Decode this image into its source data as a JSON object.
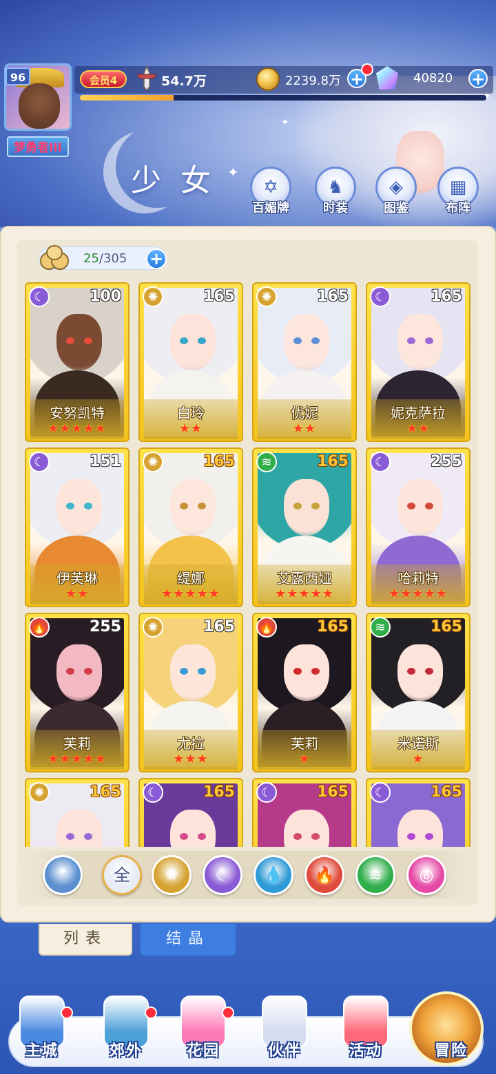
{
  "player": {
    "level": "96",
    "name": "梦勇者III",
    "vip": "会员4",
    "power": "54.7万",
    "exp_fraction": 0.23
  },
  "currency": {
    "gold": "2239.8万",
    "gems": "40820"
  },
  "page_title": "少女",
  "top_buttons": [
    {
      "label": "百媚牌",
      "icon": "card-icon"
    },
    {
      "label": "时装",
      "icon": "outfit-icon"
    },
    {
      "label": "图鉴",
      "icon": "book-icon"
    },
    {
      "label": "布阵",
      "icon": "grid-icon"
    }
  ],
  "collection": {
    "owned": "25",
    "total": "/305"
  },
  "cards": [
    {
      "name": "安努凯特",
      "level": "100",
      "element": "moon",
      "stars": "★★★★★",
      "level_gold": false,
      "hair": "#d9d2c8",
      "skin": "#7a4a33",
      "outfit": "#3a2a22",
      "eye": "#e74c3c"
    },
    {
      "name": "白玲",
      "level": "165",
      "element": "sun",
      "stars": "★★",
      "level_gold": false,
      "hair": "#eeeef2",
      "skin": "#fde3da",
      "outfit": "#f5f3f0",
      "eye": "#3aa6c9"
    },
    {
      "name": "优妮",
      "level": "165",
      "element": "sun",
      "stars": "★★",
      "level_gold": false,
      "hair": "#e8ecf7",
      "skin": "#fde6de",
      "outfit": "#f4f1f0",
      "eye": "#5b8fd6"
    },
    {
      "name": "妮克萨拉",
      "level": "165",
      "element": "moon",
      "stars": "★★",
      "level_gold": false,
      "hair": "#e6e4f3",
      "skin": "#fde6dc",
      "outfit": "#2c2430",
      "eye": "#9b6ad6"
    },
    {
      "name": "伊芙琳",
      "level": "151",
      "element": "moon",
      "stars": "★★",
      "level_gold": false,
      "hair": "#edeef4",
      "skin": "#fde5db",
      "outfit": "#e98a33",
      "eye": "#3fb6c9"
    },
    {
      "name": "缇娜",
      "level": "165",
      "element": "sun",
      "stars": "★★★★★",
      "level_gold": true,
      "hair": "#f2f0ec",
      "skin": "#fde6dc",
      "outfit": "#f2c24b",
      "eye": "#c9923a"
    },
    {
      "name": "艾露西娅",
      "level": "165",
      "element": "wind",
      "stars": "★★★★★",
      "level_gold": true,
      "hair": "#2fa6a6",
      "skin": "#fbe1d6",
      "outfit": "#f5f5f2",
      "eye": "#c8a23a"
    },
    {
      "name": "哈莉特",
      "level": "255",
      "element": "moon",
      "stars": "★★★★★",
      "level_gold": false,
      "hair": "#efeaf5",
      "skin": "#fde5dc",
      "outfit": "#8e6ad2",
      "eye": "#d44a3a"
    },
    {
      "name": "芙莉",
      "level": "255",
      "element": "fire",
      "stars": "★★★★★",
      "level_gold": false,
      "hair": "#2a1c24",
      "skin": "#f2b9c2",
      "outfit": "#3b2a30",
      "eye": "#d33a4a"
    },
    {
      "name": "尤拉",
      "level": "165",
      "element": "sun",
      "stars": "★★★",
      "level_gold": false,
      "hair": "#f6d27a",
      "skin": "#fde5d9",
      "outfit": "#f5f3ee",
      "eye": "#3a9ad6"
    },
    {
      "name": "芙莉",
      "level": "165",
      "element": "fire",
      "stars": "★",
      "level_gold": true,
      "hair": "#1d1820",
      "skin": "#fde3da",
      "outfit": "#2b1e24",
      "eye": "#d12a2a"
    },
    {
      "name": "米诺斯",
      "level": "165",
      "element": "wind",
      "stars": "★",
      "level_gold": true,
      "hair": "#222025",
      "skin": "#fde4db",
      "outfit": "#f3f3f4",
      "eye": "#c22a3a"
    },
    {
      "name": "",
      "level": "165",
      "element": "sun",
      "stars": "",
      "level_gold": true,
      "hair": "#eeeaf2",
      "skin": "#fde3da",
      "outfit": "#ffffff",
      "eye": "#9a6ad6"
    },
    {
      "name": "",
      "level": "165",
      "element": "moon",
      "stars": "",
      "level_gold": true,
      "hair": "#6a3a9a",
      "skin": "#fde3da",
      "outfit": "#5a2a7a",
      "eye": "#d44a8a"
    },
    {
      "name": "",
      "level": "165",
      "element": "moon",
      "stars": "",
      "level_gold": true,
      "hair": "#b53a8a",
      "skin": "#fde3da",
      "outfit": "#7a2a6a",
      "eye": "#d44a6a"
    },
    {
      "name": "",
      "level": "165",
      "element": "moon",
      "stars": "",
      "level_gold": true,
      "hair": "#8a6ad2",
      "skin": "#fde3da",
      "outfit": "#4a3a6a",
      "eye": "#b04ad6"
    }
  ],
  "element_styles": {
    "moon": {
      "glyph": "☾",
      "color": "#8a5bd6"
    },
    "sun": {
      "glyph": "✺",
      "color": "#d6a331"
    },
    "wind": {
      "glyph": "≋",
      "color": "#2fae4a"
    },
    "fire": {
      "glyph": "🔥",
      "color": "#e04a3a"
    },
    "water": {
      "glyph": "💧",
      "color": "#2f9ad6"
    },
    "love": {
      "glyph": "◎",
      "color": "#e64aa6"
    }
  },
  "filters": [
    {
      "name": "filter-collapse-icon",
      "glyph": "⌃",
      "color": "#5b8fd0"
    },
    {
      "name": "filter-all",
      "glyph": "全",
      "color": "#e8ecf5"
    },
    {
      "name": "filter-sun-icon",
      "glyph": "✺",
      "color": "#d6a331"
    },
    {
      "name": "filter-moon-icon",
      "glyph": "☾",
      "color": "#8a5bd6"
    },
    {
      "name": "filter-water-icon",
      "glyph": "💧",
      "color": "#2f9ad6"
    },
    {
      "name": "filter-fire-icon",
      "glyph": "🔥",
      "color": "#e04a3a"
    },
    {
      "name": "filter-wind-icon",
      "glyph": "≋",
      "color": "#2fae4a"
    },
    {
      "name": "filter-love-icon",
      "glyph": "◎",
      "color": "#e64aa6"
    }
  ],
  "tabs": [
    {
      "label": "列表",
      "active": true
    },
    {
      "label": "结晶",
      "active": false
    }
  ],
  "bottom_nav": [
    {
      "label": "主城",
      "icon": "castle-icon",
      "badge": true,
      "color": "#4a8ae0"
    },
    {
      "label": "郊外",
      "icon": "magic-circle-icon",
      "badge": true,
      "color": "#4ea0d8"
    },
    {
      "label": "花园",
      "icon": "heart-icon",
      "badge": true,
      "color": "#ff7ab8"
    },
    {
      "label": "伙伴",
      "icon": "partner-icon",
      "badge": false,
      "color": "#d6dcef"
    },
    {
      "label": "活动",
      "icon": "gift-icon",
      "badge": false,
      "color": "#ff6a7a"
    },
    {
      "label": "冒险",
      "icon": "compass-icon",
      "badge": false,
      "color": "#f0a43c"
    }
  ]
}
